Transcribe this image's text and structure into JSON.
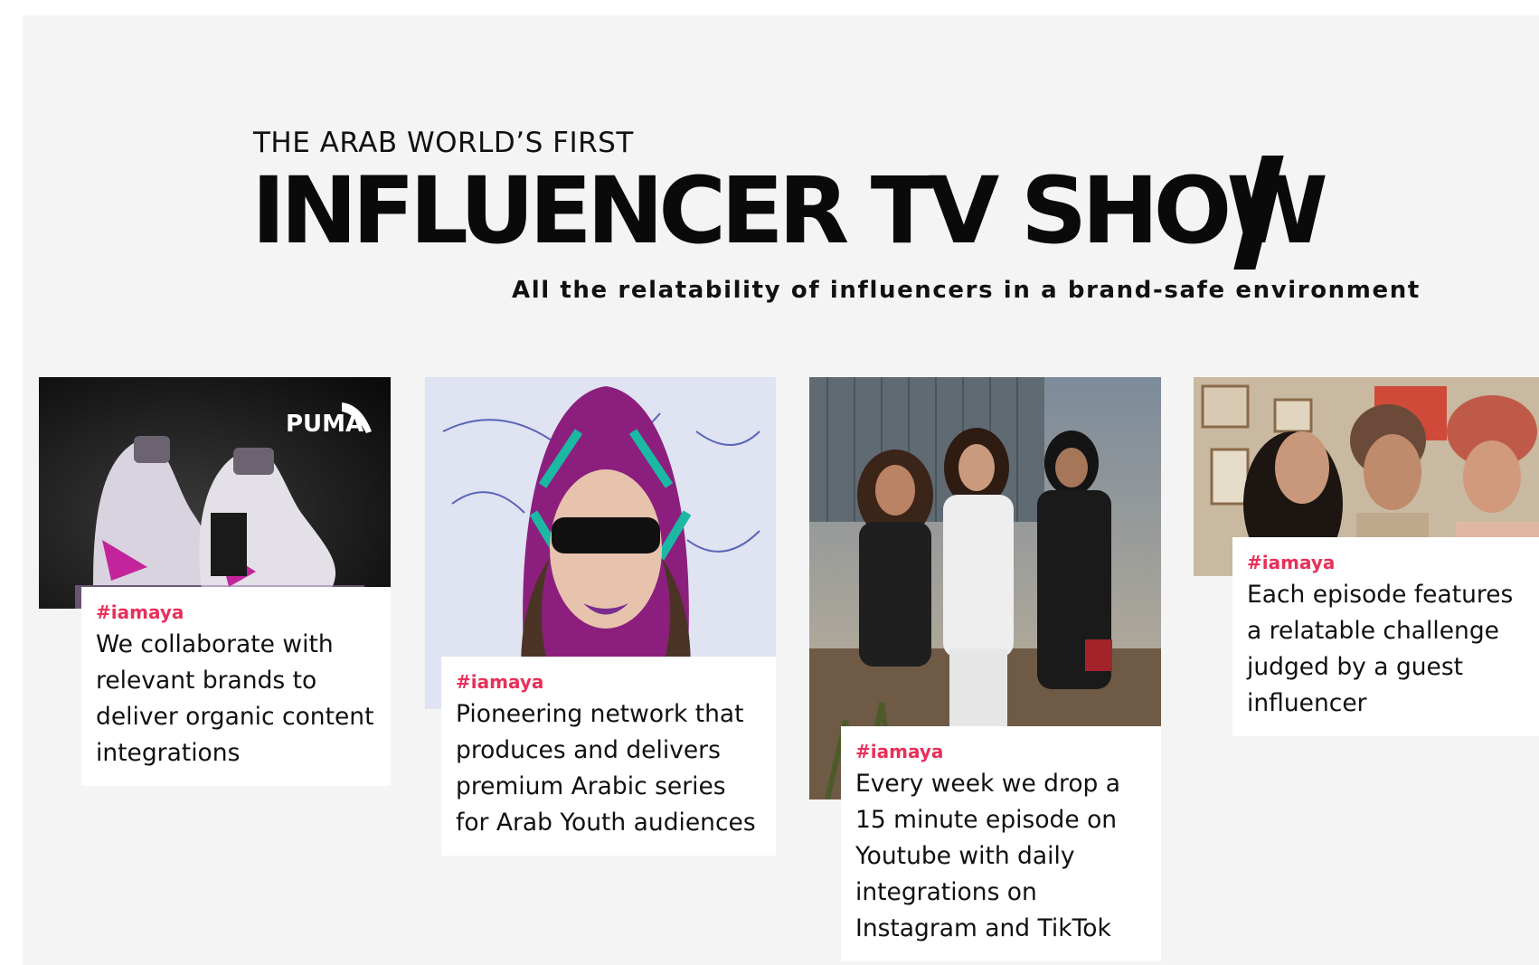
{
  "header": {
    "eyebrow": "THE ARAB WORLD’S FIRST",
    "headline": "INFLUENCER TV SHOW",
    "tagline": "All the relatability of influencers in a brand-safe environment"
  },
  "cards": [
    {
      "image": "puma-sneakers-photo",
      "image_logo": "PUMA",
      "tag": "#iamaya",
      "text": "We collaborate with relevant brands to deliver organic content integrations"
    },
    {
      "image": "influencer-hooded-sunglasses-photo",
      "tag": "#iamaya",
      "text": "Pioneering network that produces and delivers premium Arabic series for Arab Youth audiences"
    },
    {
      "image": "three-influencers-street-photo",
      "tag": "#iamaya",
      "text": "Every week we drop a 15 minute episode on Youtube with daily integrations on Instagram and TikTok"
    },
    {
      "image": "group-selfie-photo",
      "tag": "#iamaya",
      "text": "Each episode features a relatable challenge judged by a guest influencer"
    }
  ],
  "colors": {
    "panel_background": "#f4f4f4",
    "tag_color": "#e8305a",
    "headline_color": "#0a0a0a"
  }
}
